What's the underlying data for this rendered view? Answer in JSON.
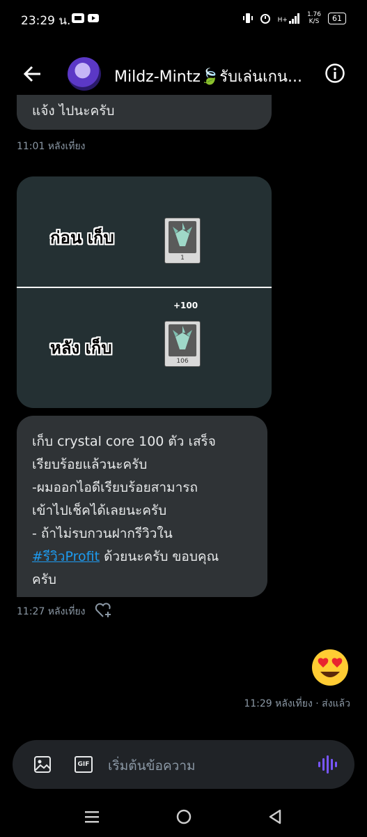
{
  "status_bar": {
    "time": "23:29 น.",
    "network": "H+",
    "speed": "1.76",
    "speed_unit": "K/S",
    "battery": "61"
  },
  "header": {
    "title": "Mildz-Mintz🍃รับเล่นเกน..."
  },
  "messages": {
    "partial_text": "แจ้ง ไปนะครับ",
    "time1": "11:01 หลังเที่ยง",
    "image": {
      "before_label": "ก่อน  เก็บ",
      "before_count": "1",
      "plus_label": "+100",
      "after_label": "หลัง  เก็บ",
      "after_count": "106"
    },
    "reply_lines": [
      "เก็บ crystal core 100 ตัว  เสร็จ",
      "เรียบร้อยแล้วนะครับ",
      "-ผมออกไอดีเรียบร้อยสามารถ",
      "เข้าไปเช็คได้เลยนะครับ",
      "- ถ้าไม่รบกวนฝากรีวิวใน"
    ],
    "hashtag": "#รีวิวProfit",
    "reply_tail": "  ด้วยนะครับ ขอบคุณ",
    "reply_last": "ครับ",
    "time2": "11:27 หลังเที่ยง",
    "sent_emoji": "😍",
    "time3": "11:29 หลังเที่ยง · ส่งแล้ว"
  },
  "composer": {
    "placeholder": "เริ่มต้นข้อความ",
    "gif_label": "GIF"
  },
  "colors": {
    "bubble": "#2f3336",
    "link": "#1d9bf0",
    "voice": "#7856ff"
  }
}
